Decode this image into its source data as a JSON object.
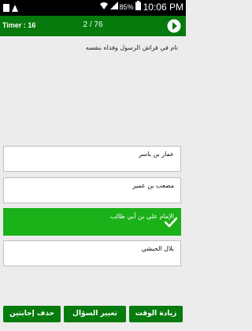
{
  "statusbar": {
    "battery": "85%",
    "time": "10:06 PM"
  },
  "topbar": {
    "timer": "Timer : 16",
    "progress": "2 / 76"
  },
  "question": "تام في فراش الرسول وفداه بنفسه",
  "answers": [
    {
      "label": "عمار بن ياسر",
      "selected": false
    },
    {
      "label": "مصعب بن عمير",
      "selected": false
    },
    {
      "label": "الإمام علي بن أبي طالب",
      "selected": true
    },
    {
      "label": "بلال الحبشي",
      "selected": false
    }
  ],
  "buttons": {
    "delete_answers": "حذف إجابتين",
    "change_question": "تغيير السؤال",
    "add_time": "زيادة الوقت"
  },
  "colors": {
    "header": "#067a0c",
    "selected": "#1bb119",
    "buttons": "#077b0e"
  }
}
